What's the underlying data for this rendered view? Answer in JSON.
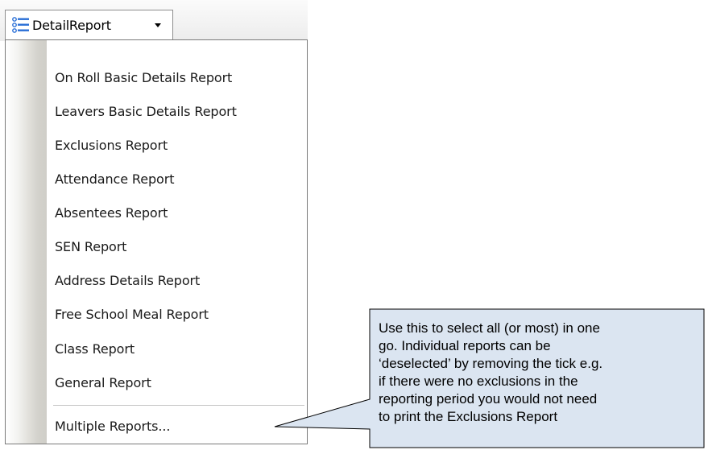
{
  "toolbar": {
    "dropdown_label": "DetailReport",
    "icon": "list-icon"
  },
  "menu": {
    "items": [
      {
        "label": "On Roll Basic Details Report"
      },
      {
        "label": "Leavers Basic Details Report"
      },
      {
        "label": "Exclusions Report"
      },
      {
        "label": "Attendance Report"
      },
      {
        "label": "Absentees Report"
      },
      {
        "label": "SEN Report"
      },
      {
        "label": "Address Details Report"
      },
      {
        "label": "Free School Meal Report"
      },
      {
        "label": "Class Report"
      },
      {
        "label": "General Report"
      }
    ],
    "multiple_label": "Multiple Reports..."
  },
  "callout": {
    "lines": [
      "Use this to select all (or most) in one",
      "go.  Individual reports can be",
      "‘deselected’ by removing the tick e.g.",
      "if there were no exclusions in the",
      "reporting period you would not need",
      "to print the Exclusions Report"
    ],
    "fill": "#dbe5f1",
    "stroke": "#000000"
  }
}
